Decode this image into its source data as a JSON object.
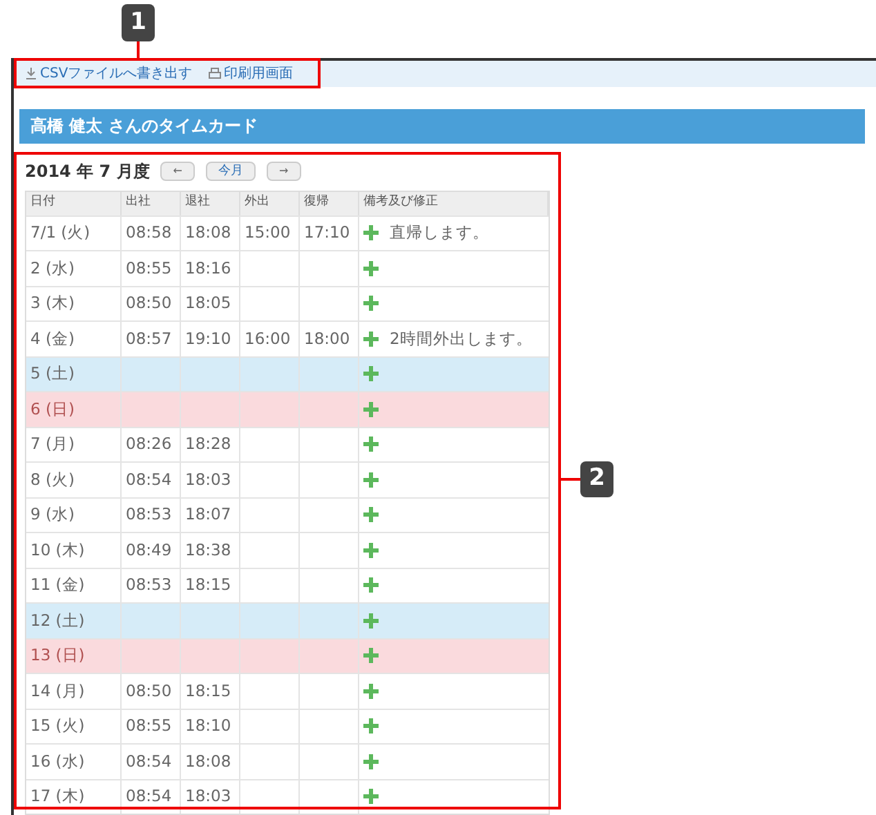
{
  "annotations": [
    "1",
    "2"
  ],
  "toolbar": {
    "links": [
      "CSVファイルへ書き出す",
      "印刷用画面"
    ]
  },
  "title": "高橋 健太 さんのタイムカード",
  "month": {
    "heading": "2014 年 7 月度",
    "prev": "←",
    "today": "今月",
    "next": "→"
  },
  "table": {
    "columns": [
      "日付",
      "出社",
      "退社",
      "外出",
      "復帰",
      "備考及び修正"
    ],
    "rows": [
      {
        "kind": "weekday",
        "cells": [
          "7/1 (火)",
          "08:58",
          "18:08",
          "15:00",
          "17:10"
        ],
        "note": "直帰します。"
      },
      {
        "kind": "weekday",
        "cells": [
          "2 (水)",
          "08:55",
          "18:16",
          "",
          ""
        ]
      },
      {
        "kind": "weekday",
        "cells": [
          "3 (木)",
          "08:50",
          "18:05",
          "",
          ""
        ]
      },
      {
        "kind": "weekday",
        "cells": [
          "4 (金)",
          "08:57",
          "19:10",
          "16:00",
          "18:00"
        ],
        "note": "2時間外出します。"
      },
      {
        "kind": "saturday",
        "cells": [
          "5 (土)",
          "",
          "",
          "",
          ""
        ]
      },
      {
        "kind": "sunday",
        "cells": [
          "6 (日)",
          "",
          "",
          "",
          ""
        ]
      },
      {
        "kind": "weekday",
        "cells": [
          "7 (月)",
          "08:26",
          "18:28",
          "",
          ""
        ]
      },
      {
        "kind": "weekday",
        "cells": [
          "8 (火)",
          "08:54",
          "18:03",
          "",
          ""
        ]
      },
      {
        "kind": "weekday",
        "cells": [
          "9 (水)",
          "08:53",
          "18:07",
          "",
          ""
        ]
      },
      {
        "kind": "weekday",
        "cells": [
          "10 (木)",
          "08:49",
          "18:38",
          "",
          ""
        ]
      },
      {
        "kind": "weekday",
        "cells": [
          "11 (金)",
          "08:53",
          "18:15",
          "",
          ""
        ]
      },
      {
        "kind": "saturday",
        "cells": [
          "12 (土)",
          "",
          "",
          "",
          ""
        ]
      },
      {
        "kind": "sunday",
        "cells": [
          "13 (日)",
          "",
          "",
          "",
          ""
        ]
      },
      {
        "kind": "weekday",
        "cells": [
          "14 (月)",
          "08:50",
          "18:15",
          "",
          ""
        ]
      },
      {
        "kind": "weekday",
        "cells": [
          "15 (火)",
          "08:55",
          "18:10",
          "",
          ""
        ]
      },
      {
        "kind": "weekday",
        "cells": [
          "16 (水)",
          "08:54",
          "18:08",
          "",
          ""
        ]
      },
      {
        "kind": "weekday",
        "cells": [
          "17 (木)",
          "08:54",
          "18:03",
          "",
          ""
        ]
      }
    ]
  }
}
